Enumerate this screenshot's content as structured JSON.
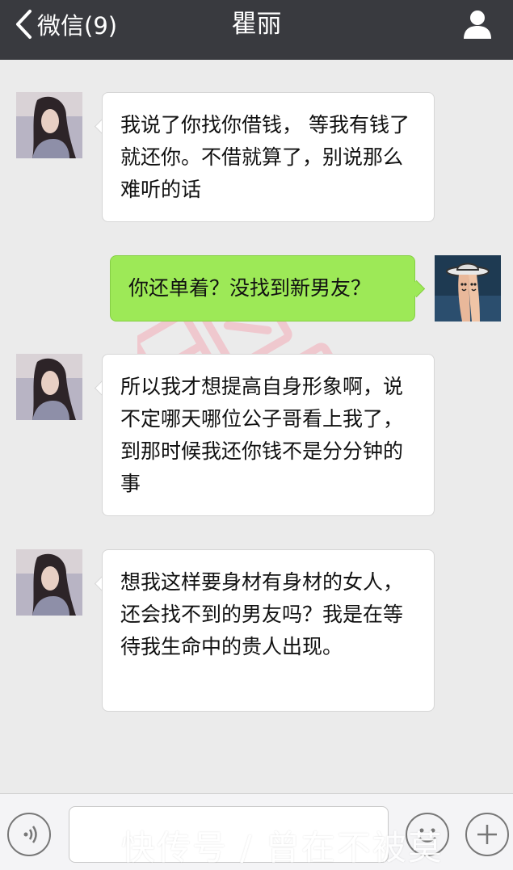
{
  "header": {
    "back_label": "微信(9)",
    "title": "瞿丽"
  },
  "messages": [
    {
      "side": "left",
      "text": "我说了你找你借钱， 等我有钱了就还你。不借就算了，别说那么难听的话"
    },
    {
      "side": "right",
      "text": "你还单着？没找到新男友？"
    },
    {
      "side": "left",
      "text": "所以我才想提高自身形象啊，说不定哪天哪位公子哥看上我了，到那时候我还你钱不是分分钟的事"
    },
    {
      "side": "left",
      "text": "想我这样要身材有身材的女人，还会找不到的男友吗？我是在等待我生命中的贵人出现。"
    }
  ],
  "footer_watermark": "快传号 / 曾在不被莫",
  "colors": {
    "topbar": "#393a3f",
    "background": "#ebebeb",
    "bubble_right": "#9de957",
    "bubble_left": "#ffffff"
  },
  "icons": [
    "chevron-left-icon",
    "user-icon",
    "voice-icon",
    "emoji-icon",
    "plus-icon"
  ]
}
